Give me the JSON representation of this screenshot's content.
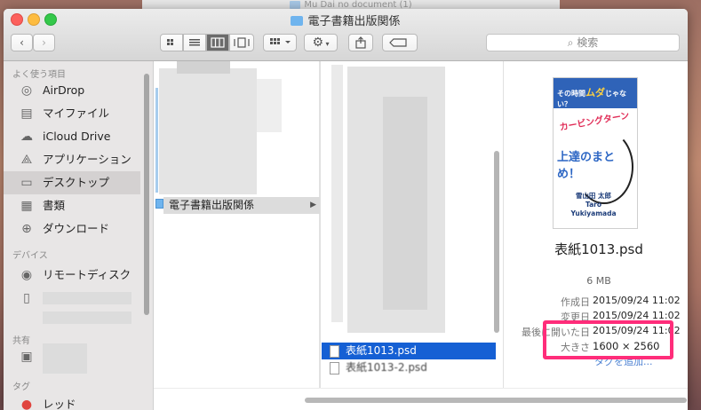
{
  "background_window": {
    "title": "Mu Dai no document  (1)"
  },
  "window": {
    "title": "電子書籍出版関係",
    "search_placeholder": "検索"
  },
  "toolbar": {
    "back_icon": "chevron-left",
    "forward_icon": "chevron-right",
    "view_icons": [
      "icon-view",
      "list-view",
      "column-view",
      "coverflow-view"
    ],
    "arrange_icon": "arrange",
    "action_icon": "gear",
    "share_icon": "share",
    "tag_icon": "tag"
  },
  "sidebar": {
    "favorites_header": "よく使う項目",
    "favorites": [
      {
        "label": "AirDrop",
        "icon": "airdrop"
      },
      {
        "label": "マイファイル",
        "icon": "all-files"
      },
      {
        "label": "iCloud Drive",
        "icon": "cloud"
      },
      {
        "label": "アプリケーション",
        "icon": "applications"
      },
      {
        "label": "デスクトップ",
        "icon": "desktop",
        "selected": true
      },
      {
        "label": "書類",
        "icon": "documents"
      },
      {
        "label": "ダウンロード",
        "icon": "downloads"
      }
    ],
    "devices_header": "デバイス",
    "devices": [
      {
        "label": "リモートディスク",
        "icon": "remote-disc"
      }
    ],
    "shared_header": "共有",
    "tags_header": "タグ",
    "tags": [
      {
        "label": "レッド",
        "color": "#e0443e"
      }
    ]
  },
  "columns": {
    "folder_selected": "電子書籍出版関係",
    "file_selected": "表紙1013.psd",
    "file_next": "表紙1013-2.psd"
  },
  "preview": {
    "cover": {
      "line1_prefix": "その時間",
      "line1_highlight": "ムダ",
      "line1_suffix": "じゃない？",
      "line2": "カービングターン",
      "line3": "上達のまとめ！",
      "author_jp": "雪山田 太郎",
      "author_en": "Taro Yukiyamada"
    },
    "filename": "表紙1013.psd",
    "size": "6 MB",
    "meta": [
      {
        "key": "作成日",
        "value": "2015/09/24 11:02"
      },
      {
        "key": "変更日",
        "value": "2015/09/24 11:02"
      },
      {
        "key": "最後に開いた日",
        "value": "2015/09/24 11:02"
      },
      {
        "key": "大きさ",
        "value": "1600 × 2560"
      }
    ],
    "add_tags": "タグを追加...",
    "highlight_color": "#ff2d7a"
  },
  "colors": {
    "selection": "#1560d4",
    "sidebar_bg": "#e8e6e6"
  }
}
